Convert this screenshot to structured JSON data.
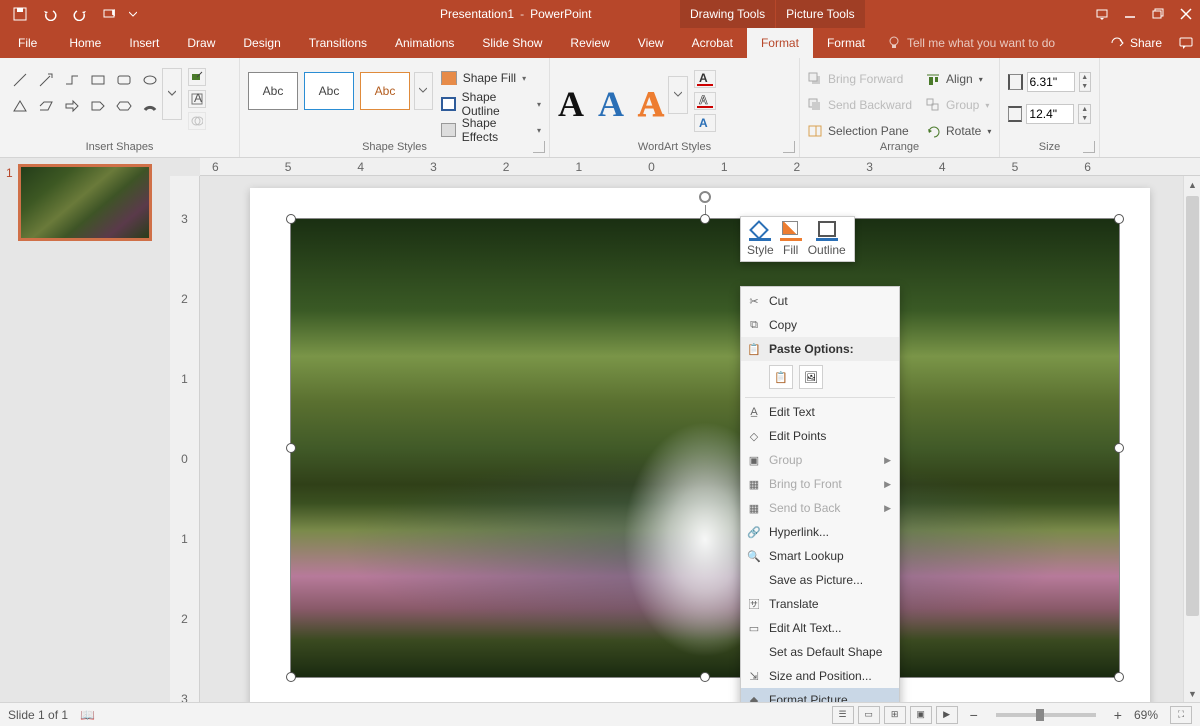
{
  "titlebar": {
    "document": "Presentation1",
    "app": "PowerPoint",
    "context_tabs": [
      "Drawing Tools",
      "Picture Tools"
    ]
  },
  "qat_icons": [
    "save-icon",
    "undo-icon",
    "redo-icon",
    "start-from-beginning-icon",
    "customize-qat-icon"
  ],
  "win_icons": [
    "ribbon-display-icon",
    "minimize-icon",
    "restore-icon",
    "close-icon"
  ],
  "ribbon": {
    "tabs": [
      "File",
      "Home",
      "Insert",
      "Draw",
      "Design",
      "Transitions",
      "Animations",
      "Slide Show",
      "Review",
      "View",
      "Acrobat",
      "Format",
      "Format"
    ],
    "active_index": 11,
    "tellme": "Tell me what you want to do",
    "share": "Share"
  },
  "groups": {
    "insert_shapes": "Insert Shapes",
    "shape_styles": "Shape Styles",
    "wordart_styles": "WordArt Styles",
    "arrange": "Arrange",
    "size": "Size"
  },
  "shape_styles": {
    "fill": "Shape Fill",
    "outline": "Shape Outline",
    "effects": "Shape Effects",
    "swatch_label": "Abc"
  },
  "wordart": {
    "text_fill": "Text Fill",
    "text_outline": "Text Outline",
    "text_effects": "Text Effects"
  },
  "arrange": {
    "bring_forward": "Bring Forward",
    "send_backward": "Send Backward",
    "selection_pane": "Selection Pane",
    "align": "Align",
    "group": "Group",
    "rotate": "Rotate"
  },
  "size": {
    "height": "6.31\"",
    "width": "12.4\""
  },
  "ruler_h": [
    "6",
    "5",
    "4",
    "3",
    "2",
    "1",
    "0",
    "1",
    "2",
    "3",
    "4",
    "5",
    "6"
  ],
  "ruler_v": [
    "3",
    "2",
    "1",
    "0",
    "1",
    "2",
    "3"
  ],
  "thumb": {
    "index": "1"
  },
  "mini_toolbar": {
    "style": "Style",
    "fill": "Fill",
    "outline": "Outline"
  },
  "context_menu": {
    "cut": "Cut",
    "copy": "Copy",
    "paste_heading": "Paste Options:",
    "edit_text": "Edit Text",
    "edit_points": "Edit Points",
    "group": "Group",
    "bring_front": "Bring to Front",
    "send_back": "Send to Back",
    "hyperlink": "Hyperlink...",
    "smart_lookup": "Smart Lookup",
    "save_as_picture": "Save as Picture...",
    "translate": "Translate",
    "edit_alt": "Edit Alt Text...",
    "set_default": "Set as Default Shape",
    "size_pos": "Size and Position...",
    "format_picture": "Format Picture..."
  },
  "statusbar": {
    "slide": "Slide 1 of 1",
    "zoom_minus": "−",
    "zoom_plus": "+",
    "zoom_val": "69%"
  }
}
